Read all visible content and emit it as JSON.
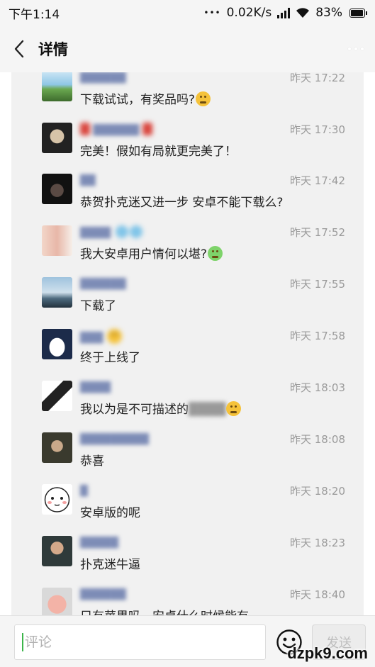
{
  "status_bar": {
    "time": "下午1:14",
    "dots": "•••",
    "network_speed": "0.02K/s",
    "battery": "83%",
    "battery_level": 0.83
  },
  "header": {
    "title": "详情",
    "back_icon": "chevron-left-icon",
    "more_icon": "more-dots-icon"
  },
  "comments": [
    {
      "time": "昨天 17:22",
      "text": "下载试试，有奖品吗?",
      "emoji": "smirk-emoji"
    },
    {
      "time": "昨天 17:30",
      "text": "完美！假如有局就更完美了！"
    },
    {
      "time": "昨天 17:42",
      "text": "恭贺扑克迷又进一步 安卓不能下载么?"
    },
    {
      "time": "昨天 17:52",
      "text": "我大安卓用户情何以堪?",
      "emoji": "crying-emoji"
    },
    {
      "time": "昨天 17:55",
      "text": "下载了"
    },
    {
      "time": "昨天 17:58",
      "text": "终于上线了"
    },
    {
      "time": "昨天 18:03",
      "text": "我以为是不可描述的",
      "emoji": "smirk-emoji"
    },
    {
      "time": "昨天 18:08",
      "text": "恭喜"
    },
    {
      "time": "昨天 18:20",
      "text": "安卓版的呢"
    },
    {
      "time": "昨天 18:23",
      "text": "扑克迷牛逼"
    },
    {
      "time": "昨天 18:40",
      "text": "只有苹果吗，安卓什么时候能有"
    }
  ],
  "input_bar": {
    "placeholder": "评论",
    "emoji_icon": "smiley-face-icon",
    "send_label": "发送"
  },
  "watermark": "dzpk9.com"
}
